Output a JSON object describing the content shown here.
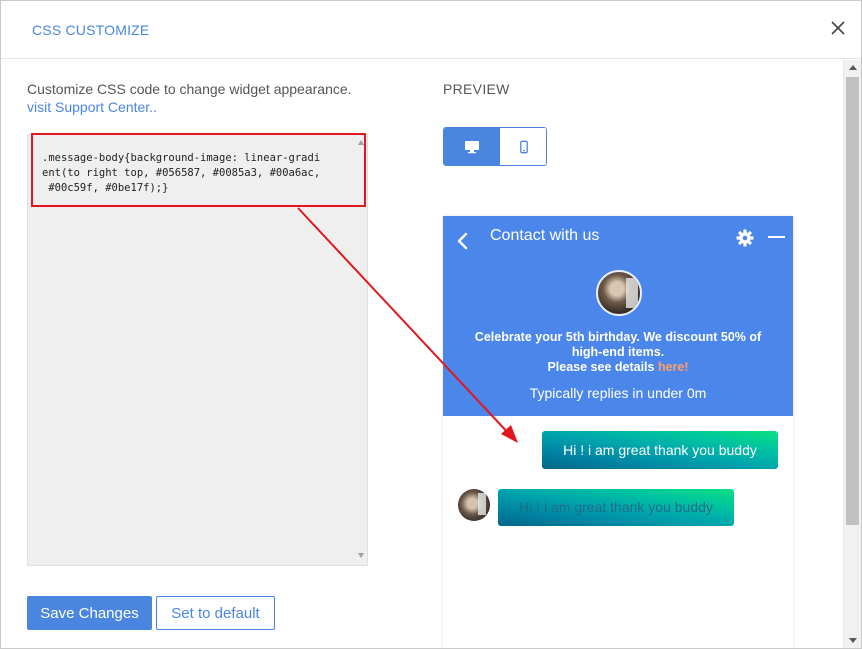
{
  "dialog": {
    "title": "CSS CUSTOMIZE",
    "close_icon": "close-icon"
  },
  "editor_panel": {
    "description": "Customize CSS code to change widget appearance.",
    "support_link": "visit Support Center..",
    "css_code": ".message-body{background-image: linear-gradi\nent(to right top, #056587, #0085a3, #00a6ac,\n #00c59f, #0be17f);}",
    "save_label": "Save Changes",
    "default_label": "Set to default"
  },
  "preview": {
    "label": "PREVIEW",
    "desktop_icon": "desktop-icon",
    "mobile_icon": "mobile-icon",
    "selected_device": "desktop"
  },
  "widget": {
    "title": "Contact with us",
    "announcement_main": "Celebrate your 5th birthday. We discount 50% of high-end items.",
    "announcement_details": "Please see details ",
    "announcement_link": "here!",
    "replies": "Typically replies in under 0m",
    "outgoing_message": "Hi ! i am great thank you buddy",
    "incoming_message": "Hi ! i am great thank you buddy"
  },
  "colors": {
    "accent": "#4a86e0",
    "widget_header": "#4b86ea",
    "annotation": "#e3161d",
    "gradient": [
      "#056587",
      "#0085a3",
      "#00a6ac",
      "#00c59f",
      "#0be17f"
    ]
  }
}
